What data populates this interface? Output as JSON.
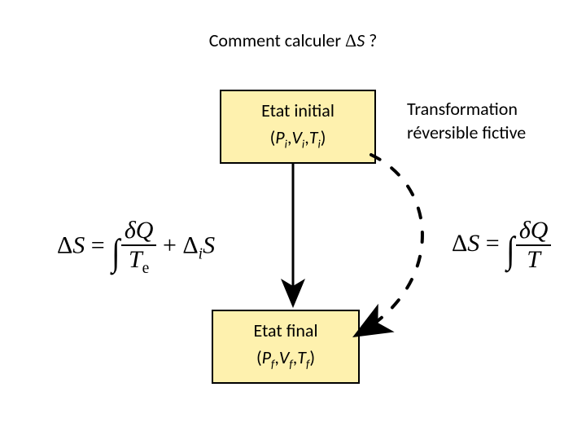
{
  "title_prefix": "Comment calculer ",
  "title_delta": "Δ",
  "title_var": "S",
  "title_suffix": " ?",
  "initial": {
    "label": "Etat initial",
    "p": "P",
    "v": "V",
    "t": "T",
    "sub": "i"
  },
  "final": {
    "label": "Etat final",
    "p": "P",
    "v": "V",
    "t": "T",
    "sub": "f"
  },
  "side": {
    "l1": "Transformation",
    "l2": "réversible fictive"
  },
  "eq_left": {
    "lhs_delta": "Δ",
    "lhs_var": "S",
    "eq": "=",
    "num_delta": "δ",
    "num_var": "Q",
    "den": "T",
    "den_sub": "e",
    "plus": "+",
    "t2_delta": "Δ",
    "t2_sub": "i",
    "t2_var": "S"
  },
  "eq_right": {
    "lhs_delta": "Δ",
    "lhs_var": "S",
    "eq": "=",
    "num_delta": "δ",
    "num_var": "Q",
    "den": "T"
  }
}
